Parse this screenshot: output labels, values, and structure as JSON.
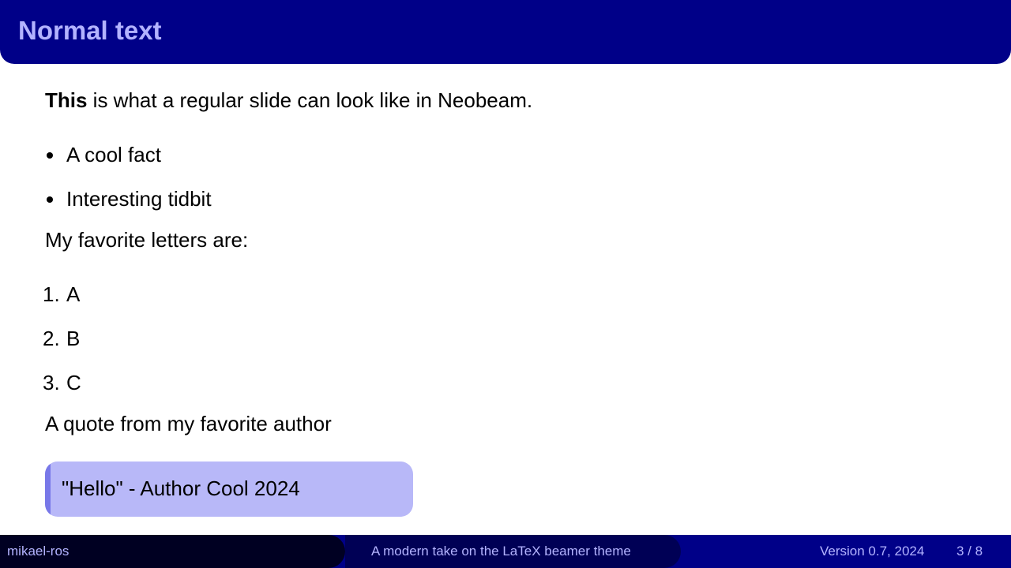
{
  "slide": {
    "title": "Normal text",
    "intro_bold": "This",
    "intro_rest": " is what a regular slide can look like in Neobeam.",
    "bullets": [
      "A cool fact",
      "Interesting tidbit"
    ],
    "letters_intro": "My favorite letters are:",
    "enumeration": [
      {
        "number": "1.",
        "text": "A"
      },
      {
        "number": "2.",
        "text": "B"
      },
      {
        "number": "3.",
        "text": "C"
      }
    ],
    "quote_intro": "A quote from my favorite author",
    "quote": "\"Hello\" - Author Cool 2024"
  },
  "footer": {
    "author": "mikael-ros",
    "presentation_title": "A modern take on the LaTeX beamer theme",
    "version": "Version 0.7, 2024",
    "page": "3 / 8"
  },
  "colors": {
    "header_background": "#000088",
    "title_text": "#b3b3ff",
    "quote_background": "#b8b8f8",
    "quote_accent": "#7878e8",
    "footer_left": "#000022",
    "footer_mid": "#000055"
  }
}
